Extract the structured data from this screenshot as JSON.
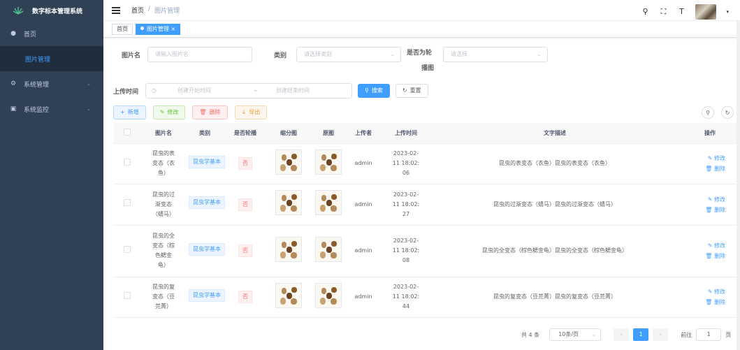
{
  "app": {
    "title": "数字标本管理系统"
  },
  "sidebar": {
    "items": [
      {
        "label": "首页",
        "icon": "dashboard-icon"
      },
      {
        "label": "图片管理",
        "icon": "",
        "active": true
      },
      {
        "label": "系统管理",
        "icon": "system-icon",
        "arrow": "⌄"
      },
      {
        "label": "系统监控",
        "icon": "monitor-icon",
        "arrow": "⌄"
      }
    ]
  },
  "navbar": {
    "breadcrumb": [
      "首页",
      "/",
      "图片管理"
    ]
  },
  "tags": {
    "home": "首页",
    "current": "图片管理 ×"
  },
  "search": {
    "name_label": "图片名",
    "name_placeholder": "请输入图片名",
    "category_label": "类别",
    "category_placeholder": "请选择类别",
    "carousel_label_1": "是否为轮",
    "carousel_label_2": "播图",
    "carousel_placeholder": "请选择",
    "time_label": "上传时间",
    "start_placeholder": "创建开始时间",
    "time_sep": "-",
    "end_placeholder": "创建结束时间",
    "search_button": "搜索",
    "reset_button": "重置"
  },
  "toolbar": {
    "add": "新增",
    "edit": "修改",
    "delete": "删除",
    "export": "导出"
  },
  "table": {
    "headers": [
      "",
      "图片名",
      "类别",
      "是否轮播",
      "缩分图",
      "原图",
      "上传者",
      "上传时间",
      "文字描述",
      "操作"
    ],
    "rows": [
      {
        "name": [
          "昆虫的表",
          "变态（衣",
          "鱼）"
        ],
        "category": "昆虫学基本",
        "carousel": "否",
        "uploader": "admin",
        "time": [
          "2023-02-",
          "11 18:02:",
          "06"
        ],
        "desc": "昆虫的表变态（衣鱼）昆虫的表变态（衣鱼）",
        "edit": "修改",
        "delete": "删除"
      },
      {
        "name": [
          "昆虫的过",
          "渐变态",
          "（蜻马）"
        ],
        "category": "昆虫学基本",
        "carousel": "否",
        "uploader": "admin",
        "time": [
          "2023-02-",
          "11 18:02:",
          "27"
        ],
        "desc": "昆虫的过渐变态（蜻马）昆虫的过渐变态（蜻马）",
        "edit": "修改",
        "delete": "删除"
      },
      {
        "name": [
          "昆虫的全",
          "变态（棕",
          "色鳃金",
          "龟）"
        ],
        "category": "昆虫学基本",
        "carousel": "否",
        "uploader": "admin",
        "time": [
          "2023-02-",
          "11 18:02:",
          "08"
        ],
        "desc": "昆虫的全变态（棕色鳃金龟）昆虫的全变态（棕色鳃金龟）",
        "edit": "修改",
        "delete": "删除"
      },
      {
        "name": [
          "昆虫的复",
          "变态（豆",
          "芫菁）"
        ],
        "category": "昆虫学基本",
        "carousel": "否",
        "uploader": "admin",
        "time": [
          "2023-02-",
          "11 18:02:",
          "44"
        ],
        "desc": "昆虫的复变态（豆芫菁）昆虫的复变态（豆芫菁）",
        "edit": "修改",
        "delete": "删除"
      }
    ]
  },
  "pagination": {
    "total": "共 4 条",
    "page_size": "10条/页",
    "current_page": "1",
    "goto_label": "前往",
    "goto_value": "1",
    "page_unit": "页"
  },
  "colors": {
    "primary": "#409eff",
    "sidebar": "#304156"
  }
}
